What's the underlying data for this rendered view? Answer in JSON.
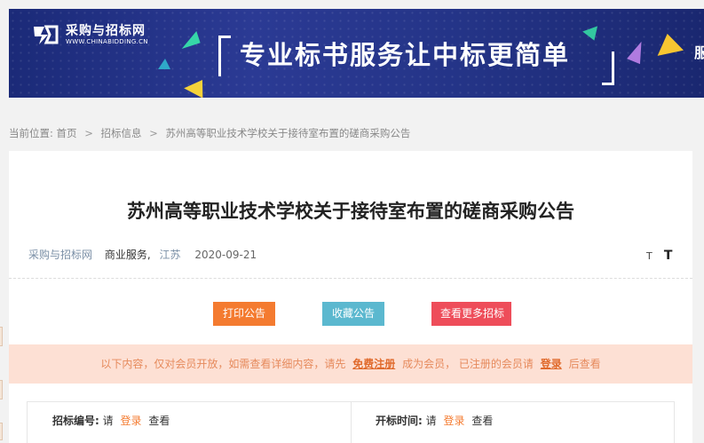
{
  "banner": {
    "logo_cn": "采购与招标网",
    "logo_en": "WWW.CHINABIDDING.CN",
    "slogan": "专业标书服务让中标更简单",
    "tail": "服务"
  },
  "breadcrumb": {
    "prefix": "当前位置:",
    "items": [
      "首页",
      "招标信息",
      "苏州高等职业技术学校关于接待室布置的磋商采购公告"
    ],
    "separator": ">"
  },
  "article": {
    "title": "苏州高等职业技术学校关于接待室布置的磋商采购公告",
    "source": "采购与招标网",
    "category": "商业服务,",
    "location": "江苏",
    "date": "2020-09-21",
    "font_small": "T",
    "font_large": "T"
  },
  "actions": {
    "print": "打印公告",
    "favorite": "收藏公告",
    "more": "查看更多招标"
  },
  "notice": {
    "text1": "以下内容，仅对会员开放，如需查看详细内容，请先",
    "register": "免费注册",
    "text2": "成为会员，  已注册的会员请",
    "login": "登录",
    "text3": "后查看"
  },
  "info": {
    "bid_no_label": "招标编号:",
    "bid_time_label": "开标时间:",
    "please": "请",
    "login": "登录",
    "view": "查看"
  },
  "colors": {
    "banner_bg": "#243487",
    "print_btn": "#f47b30",
    "fav_btn": "#5bb8cf",
    "more_btn": "#ee4d5a",
    "notice_bg": "#fde0d4"
  }
}
